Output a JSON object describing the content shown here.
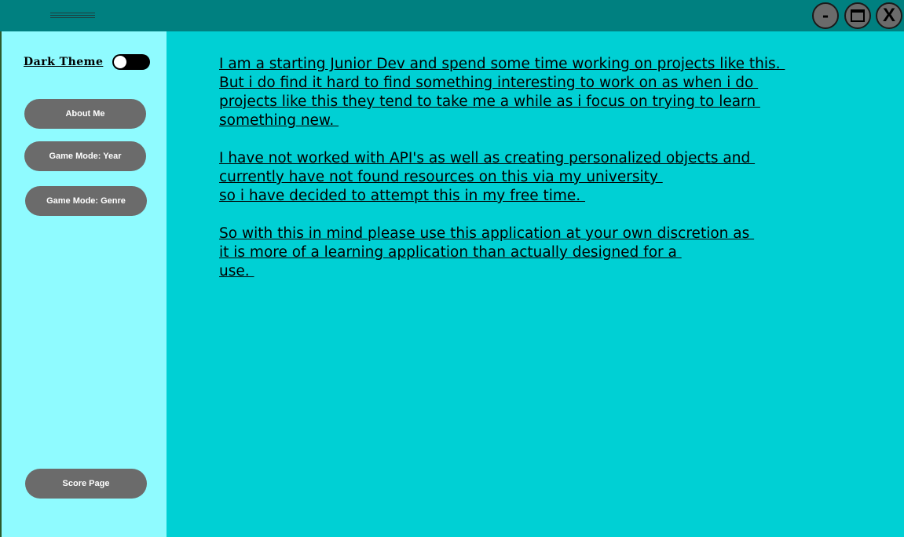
{
  "window": {
    "minimize_label": "-",
    "close_label": "X"
  },
  "sidebar": {
    "theme_toggle_label": "Dark Theme",
    "theme_toggle_on": true,
    "buttons": [
      {
        "label": "About Me"
      },
      {
        "label": "Game Mode: Year"
      },
      {
        "label": "Game Mode: Genre"
      },
      {
        "label": "Score Page"
      }
    ]
  },
  "main": {
    "paragraphs": [
      [
        "I am a starting Junior Dev and spend some time working on projects like this. ",
        "But i do find it hard to find something interesting to work on as when i do ",
        "projects like this they tend to take me a while as i focus on trying to learn ",
        "something new. "
      ],
      [
        "I have not worked with API's as well as creating personalized objects and ",
        "currently have not found resources on this via my university ",
        "so i have decided to attempt this in my free time. "
      ],
      [
        "So with this in mind please use this application at your own discretion as ",
        "it is more of a learning application than actually designed for a ",
        "use. "
      ]
    ]
  },
  "colors": {
    "titlebar": "#008080",
    "sidebar": "#8ffbff",
    "main": "#00d0d4",
    "button": "#6b6b6b"
  }
}
